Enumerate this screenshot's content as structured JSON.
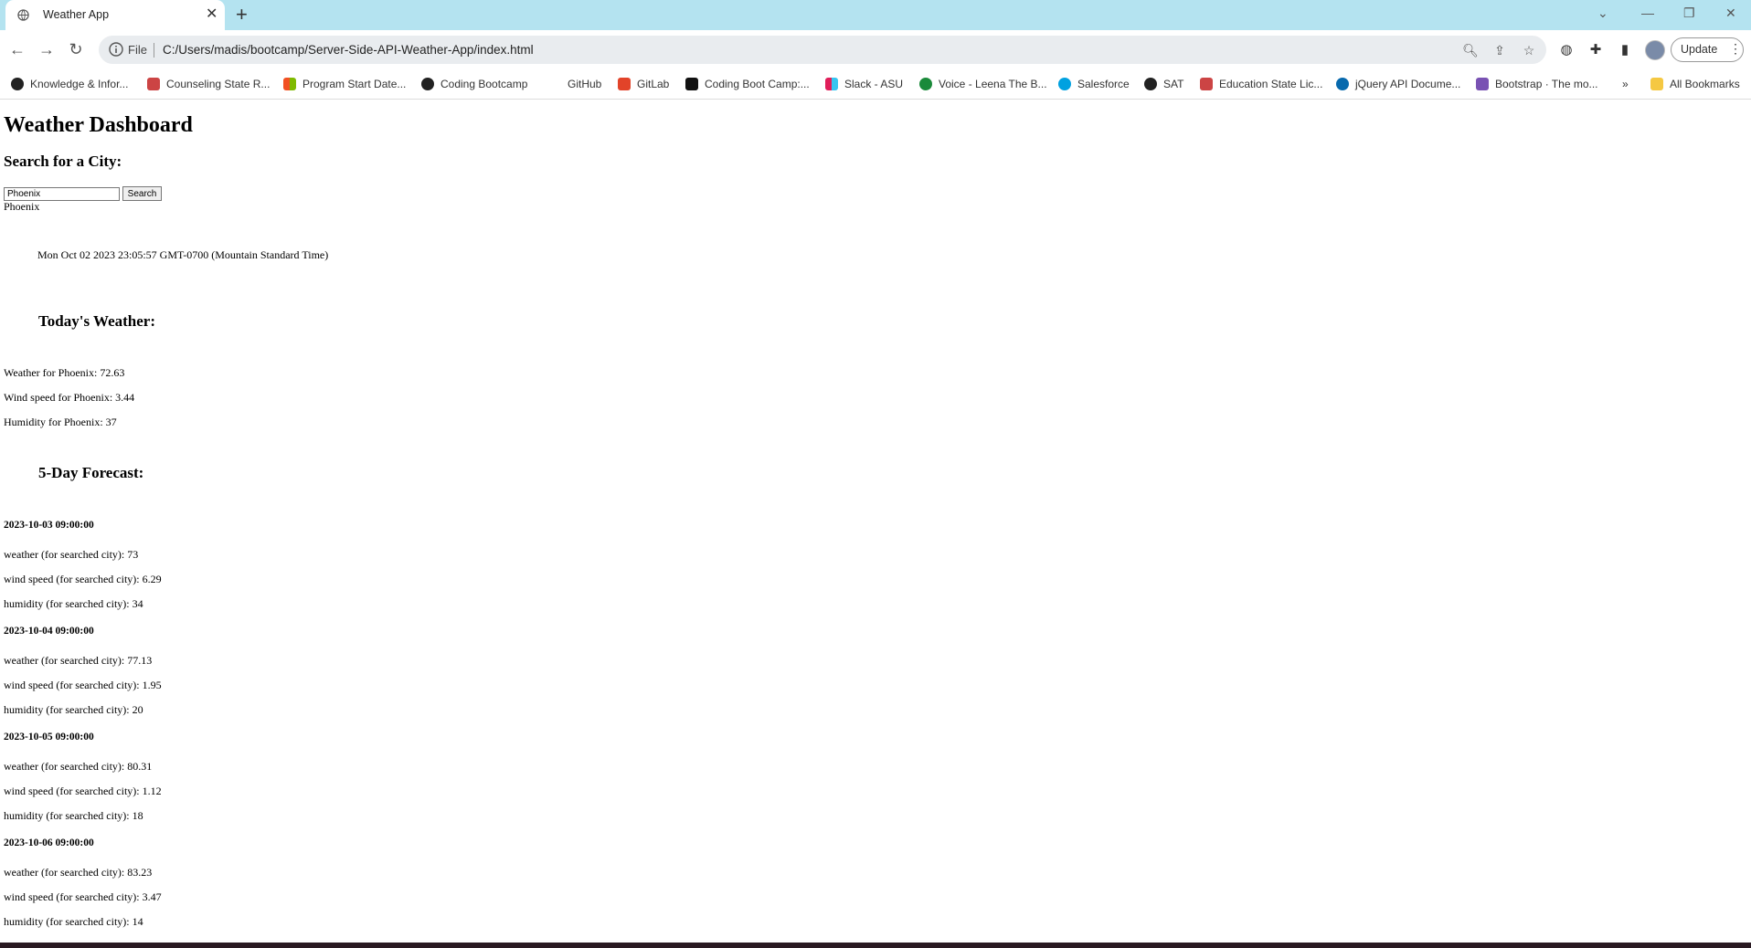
{
  "browser": {
    "tab_title": "Weather App",
    "url_scheme": "File",
    "url": "C:/Users/madis/bootcamp/Server-Side-API-Weather-App/index.html",
    "update_label": "Update",
    "bookmarks": [
      {
        "label": "Knowledge & Infor...",
        "icon": "github-icon"
      },
      {
        "label": "Counseling State R...",
        "icon": "asu-icon"
      },
      {
        "label": "Program Start Date...",
        "icon": "microsoft-icon"
      },
      {
        "label": "Coding Bootcamp",
        "icon": "github-icon"
      },
      {
        "label": "GitHub",
        "icon": "blank-icon"
      },
      {
        "label": "GitLab",
        "icon": "gitlab-icon"
      },
      {
        "label": "Coding Boot Camp:...",
        "icon": "bootcamp-icon"
      },
      {
        "label": "Slack - ASU",
        "icon": "slack-icon"
      },
      {
        "label": "Voice - Leena The B...",
        "icon": "voice-icon"
      },
      {
        "label": "Salesforce",
        "icon": "salesforce-icon"
      },
      {
        "label": "SAT",
        "icon": "github-icon"
      },
      {
        "label": "Education State Lic...",
        "icon": "asu-icon"
      },
      {
        "label": "jQuery API Docume...",
        "icon": "jquery-icon"
      },
      {
        "label": "Bootstrap · The mo...",
        "icon": "bootstrap-icon"
      }
    ],
    "overflow_label": "»",
    "all_bookmarks_label": "All Bookmarks"
  },
  "page": {
    "title": "Weather Dashboard",
    "search_heading": "Search for a City:",
    "search_value": "Phoenix",
    "search_button": "Search",
    "city_name": "Phoenix",
    "date_string": "Mon Oct 02 2023 23:05:57 GMT-0700 (Mountain Standard Time)",
    "today_heading": "Today's Weather:",
    "today_lines": [
      "Weather for Phoenix: 72.63",
      "Wind speed for Phoenix: 3.44",
      "Humidity for Phoenix: 37"
    ],
    "forecast_heading": "5-Day Forecast:",
    "forecast": [
      {
        "date": "2023-10-03 09:00:00",
        "weather": "weather (for searched city): 73",
        "wind": "wind speed (for searched city): 6.29",
        "humidity": "humidity (for searched city): 34"
      },
      {
        "date": "2023-10-04 09:00:00",
        "weather": "weather (for searched city): 77.13",
        "wind": "wind speed (for searched city): 1.95",
        "humidity": "humidity (for searched city): 20"
      },
      {
        "date": "2023-10-05 09:00:00",
        "weather": "weather (for searched city): 80.31",
        "wind": "wind speed (for searched city): 1.12",
        "humidity": "humidity (for searched city): 18"
      },
      {
        "date": "2023-10-06 09:00:00",
        "weather": "weather (for searched city): 83.23",
        "wind": "wind speed (for searched city): 3.47",
        "humidity": "humidity (for searched city): 14"
      }
    ]
  },
  "colors": {
    "tabbar": "#b4e3f0",
    "omnibox": "#e9ecef"
  }
}
